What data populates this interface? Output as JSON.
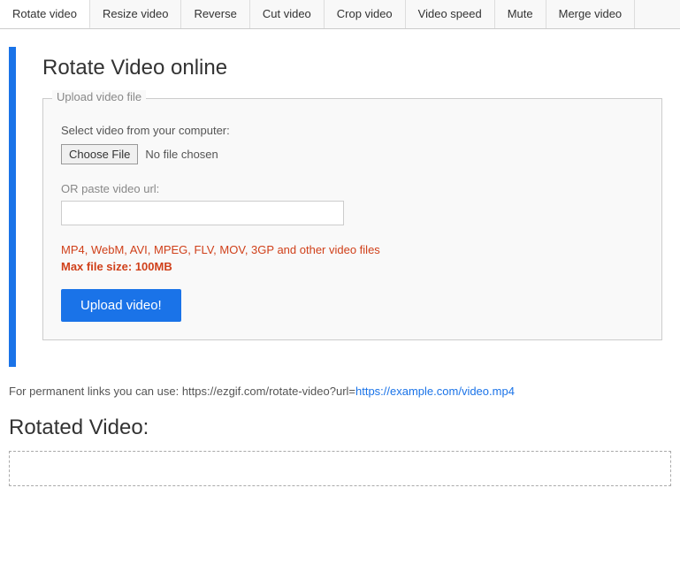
{
  "tabs": [
    {
      "id": "rotate",
      "label": "Rotate video",
      "active": true
    },
    {
      "id": "resize",
      "label": "Resize video",
      "active": false
    },
    {
      "id": "reverse",
      "label": "Reverse",
      "active": false
    },
    {
      "id": "cut",
      "label": "Cut video",
      "active": false
    },
    {
      "id": "crop",
      "label": "Crop video",
      "active": false
    },
    {
      "id": "speed",
      "label": "Video speed",
      "active": false
    },
    {
      "id": "mute",
      "label": "Mute",
      "active": false
    },
    {
      "id": "merge",
      "label": "Merge video",
      "active": false
    }
  ],
  "page": {
    "title": "Rotate Video online",
    "upload_section": {
      "legend": "Upload video file",
      "select_label": "Select video from your computer:",
      "choose_file_btn": "Choose File",
      "no_file_text": "No file chosen",
      "or_paste_label": "OR paste video url:",
      "url_placeholder": "",
      "formats_text": "MP4, WebM, AVI, MPEG, FLV, MOV, 3GP and other video files",
      "max_size_label": "Max file size: ",
      "max_size_value": "100MB",
      "upload_btn": "Upload video!"
    },
    "permanent_links": {
      "prefix": "For permanent links you can use: https://ezgif.com/rotate-video?url=",
      "link_text": "https://example.com/video.mp4",
      "link_href": "https://example.com/video.mp4"
    },
    "rotated_section": {
      "title": "Rotated Video:"
    }
  }
}
